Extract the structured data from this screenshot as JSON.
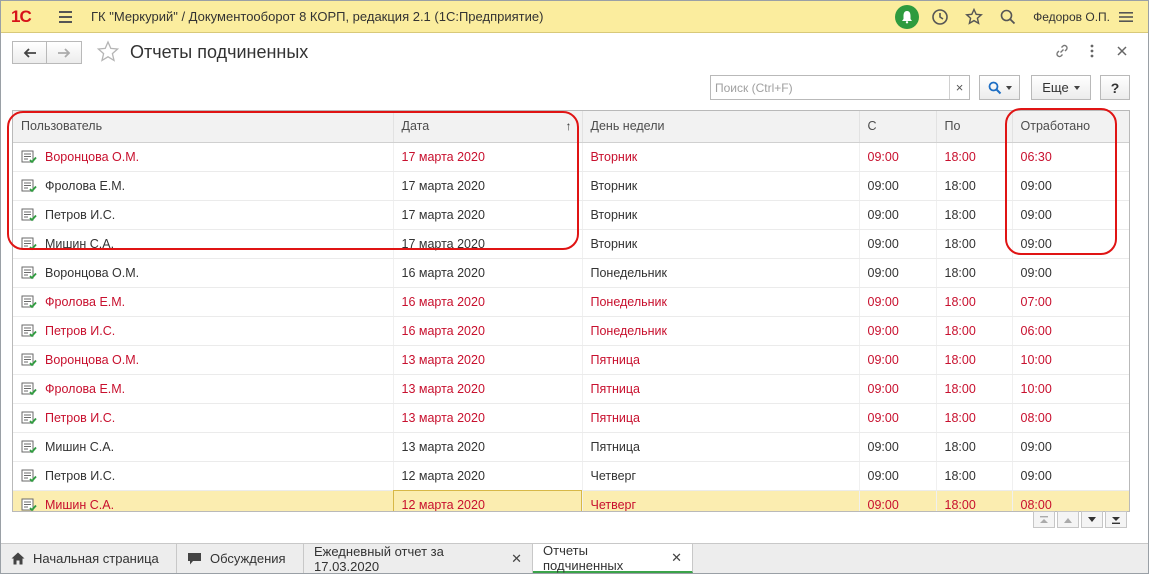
{
  "app": {
    "logo": "1С",
    "title": "ГК \"Меркурий\" / Документооборот 8 КОРП, редакция 2.1  (1С:Предприятие)",
    "user": "Федоров О.П."
  },
  "form": {
    "title": "Отчеты подчиненных"
  },
  "search": {
    "placeholder": "Поиск (Ctrl+F)",
    "clear": "×",
    "more_label": "Еще",
    "help_label": "?"
  },
  "table": {
    "columns": [
      "Пользователь",
      "Дата",
      "День недели",
      "С",
      "По",
      "Отработано"
    ],
    "sort_indicator": "↑",
    "rows": [
      {
        "user": "Воронцова О.М.",
        "date": "17 марта 2020",
        "day": "Вторник",
        "from": "09:00",
        "to": "18:00",
        "worked": "06:30",
        "highlight": true,
        "selected": false
      },
      {
        "user": "Фролова Е.М.",
        "date": "17 марта 2020",
        "day": "Вторник",
        "from": "09:00",
        "to": "18:00",
        "worked": "09:00",
        "highlight": false,
        "selected": false
      },
      {
        "user": "Петров И.С.",
        "date": "17 марта 2020",
        "day": "Вторник",
        "from": "09:00",
        "to": "18:00",
        "worked": "09:00",
        "highlight": false,
        "selected": false
      },
      {
        "user": "Мишин С.А.",
        "date": "17 марта 2020",
        "day": "Вторник",
        "from": "09:00",
        "to": "18:00",
        "worked": "09:00",
        "highlight": false,
        "selected": false
      },
      {
        "user": "Воронцова О.М.",
        "date": "16 марта 2020",
        "day": "Понедельник",
        "from": "09:00",
        "to": "18:00",
        "worked": "09:00",
        "highlight": false,
        "selected": false
      },
      {
        "user": "Фролова Е.М.",
        "date": "16 марта 2020",
        "day": "Понедельник",
        "from": "09:00",
        "to": "18:00",
        "worked": "07:00",
        "highlight": true,
        "selected": false
      },
      {
        "user": "Петров И.С.",
        "date": "16 марта 2020",
        "day": "Понедельник",
        "from": "09:00",
        "to": "18:00",
        "worked": "06:00",
        "highlight": true,
        "selected": false
      },
      {
        "user": "Воронцова О.М.",
        "date": "13 марта 2020",
        "day": "Пятница",
        "from": "09:00",
        "to": "18:00",
        "worked": "10:00",
        "highlight": true,
        "selected": false
      },
      {
        "user": "Фролова Е.М.",
        "date": "13 марта 2020",
        "day": "Пятница",
        "from": "09:00",
        "to": "18:00",
        "worked": "10:00",
        "highlight": true,
        "selected": false
      },
      {
        "user": "Петров И.С.",
        "date": "13 марта 2020",
        "day": "Пятница",
        "from": "09:00",
        "to": "18:00",
        "worked": "08:00",
        "highlight": true,
        "selected": false
      },
      {
        "user": "Мишин С.А.",
        "date": "13 марта 2020",
        "day": "Пятница",
        "from": "09:00",
        "to": "18:00",
        "worked": "09:00",
        "highlight": false,
        "selected": false
      },
      {
        "user": "Петров И.С.",
        "date": "12 марта 2020",
        "day": "Четверг",
        "from": "09:00",
        "to": "18:00",
        "worked": "09:00",
        "highlight": false,
        "selected": false
      },
      {
        "user": "Мишин С.А.",
        "date": "12 марта 2020",
        "day": "Четверг",
        "from": "09:00",
        "to": "18:00",
        "worked": "08:00",
        "highlight": true,
        "selected": true
      }
    ]
  },
  "bottom_tabs": [
    {
      "label": "Начальная страница",
      "icon": "home-icon",
      "active": false,
      "closable": false
    },
    {
      "label": "Обсуждения",
      "icon": "discussions-icon",
      "active": false,
      "closable": false
    },
    {
      "label": "Ежедневный отчет за 17.03.2020",
      "icon": "",
      "active": false,
      "closable": true
    },
    {
      "label": "Отчеты подчиненных",
      "icon": "",
      "active": true,
      "closable": true
    }
  ],
  "colors": {
    "highlight_text": "#c8102e",
    "top_bar": "#fbed9e",
    "selected_row": "#fbedb0",
    "annotation_oval": "#e01414",
    "active_tab_accent": "#3aa34a"
  }
}
